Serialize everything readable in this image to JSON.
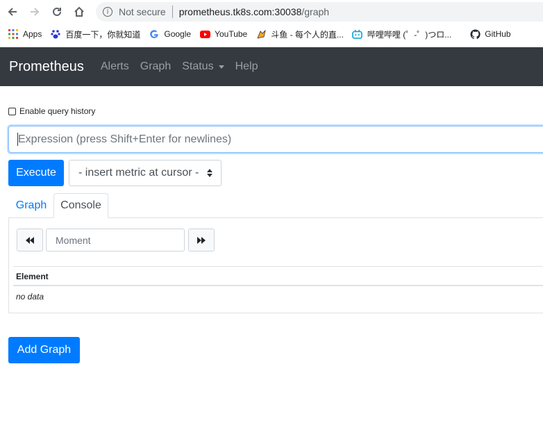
{
  "browser": {
    "address": {
      "security_label": "Not secure",
      "host": "prometheus.tk8s.com:30038",
      "path": "/graph",
      "info_glyph": "i"
    },
    "bookmarks": [
      {
        "label": "Apps",
        "icon": "apps-grid-icon"
      },
      {
        "label": "百度一下，你就知道",
        "icon": "baidu-icon"
      },
      {
        "label": "Google",
        "icon": "google-icon"
      },
      {
        "label": "YouTube",
        "icon": "youtube-icon"
      },
      {
        "label": "斗鱼 - 每个人的直...",
        "icon": "douyu-icon"
      },
      {
        "label": "哔哩哔哩 (゜-゜)つロ...",
        "icon": "bilibili-icon"
      },
      {
        "label": "GitHub",
        "icon": "github-icon"
      }
    ]
  },
  "navbar": {
    "brand": "Prometheus",
    "links": [
      "Alerts",
      "Graph",
      "Status",
      "Help"
    ],
    "background": "#343a40"
  },
  "query": {
    "history_label": "Enable query history",
    "expression_placeholder": "Expression (press Shift+Enter for newlines)",
    "execute_label": "Execute",
    "metric_select_value": "- insert metric at cursor -"
  },
  "tabs": [
    {
      "label": "Graph",
      "active": false
    },
    {
      "label": "Console",
      "active": true
    }
  ],
  "console": {
    "moment_placeholder": "Moment",
    "table_header": "Element",
    "empty_text": "no data"
  },
  "add_graph_label": "Add Graph",
  "colors": {
    "primary": "#007bff",
    "link": "#007bff"
  }
}
